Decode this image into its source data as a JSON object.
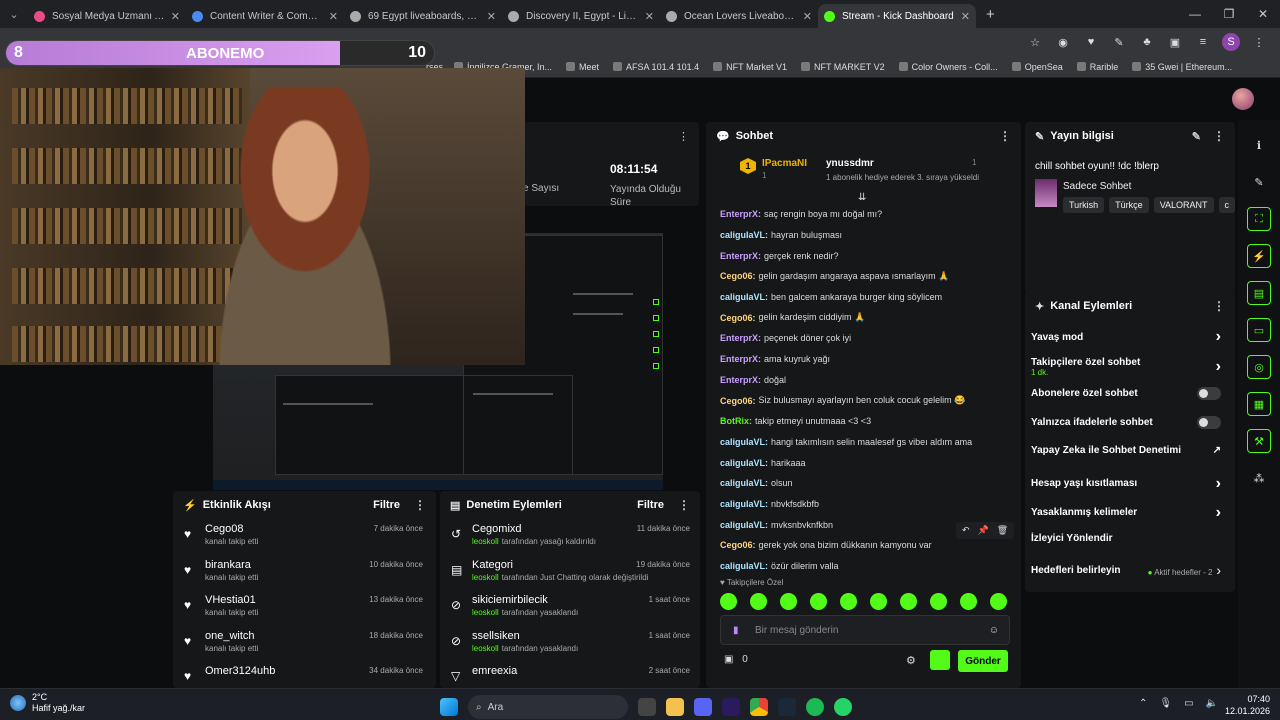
{
  "browser": {
    "tabs": [
      {
        "title": "Sosyal Medya Uzmanı Aranıyor",
        "color": "#e94b8a"
      },
      {
        "title": "Content Writer & Community M",
        "color": "#4b8af0"
      },
      {
        "title": "69 Egypt liveaboards, May 2026",
        "color": "#aaaaaa"
      },
      {
        "title": "Discovery II, Egypt - LiveAboard",
        "color": "#aaaaaa"
      },
      {
        "title": "Ocean Lovers Liveaboard, Egypt",
        "color": "#aaaaaa"
      },
      {
        "title": "Stream - Kick Dashboard",
        "color": "#53fc18",
        "active": true
      }
    ],
    "bookmarks": [
      "İngilizce Gramer, In...",
      "Meet",
      "AFSA 101.4 101.4",
      "NFT Market V1",
      "NFT MARKET V2",
      "Color Owners - Coll...",
      "OpenSea",
      "Rarible",
      "35 Gwei | Ethereum..."
    ],
    "bookmark_partial": "rses"
  },
  "overlay": {
    "left": "8",
    "title": "ABONEMO",
    "right": "10",
    "progress": 0.78
  },
  "stats": {
    "time": "08:11:54",
    "time_label": "Yayında Olduğu Süre",
    "viewers_label": "e Sayısı"
  },
  "activity": {
    "title": "Etkinlik Akışı",
    "filter": "Filtre",
    "items": [
      {
        "name": "Cego08",
        "sub": "kanalı takip etti",
        "time": "7 dakika önce"
      },
      {
        "name": "birankara",
        "sub": "kanalı takip etti",
        "time": "10 dakika önce"
      },
      {
        "name": "VHestia01",
        "sub": "kanalı takip etti",
        "time": "13 dakika önce"
      },
      {
        "name": "one_witch",
        "sub": "kanalı takip etti",
        "time": "18 dakika önce"
      },
      {
        "name": "Omer3124uhb",
        "sub": "",
        "time": "34 dakika önce"
      }
    ]
  },
  "moderation": {
    "title": "Denetim Eylemleri",
    "filter": "Filtre",
    "items": [
      {
        "name": "Cegomixd",
        "actor": "leoskoll",
        "action": "tarafından yasağı kaldırıldı",
        "time": "11 dakika önce"
      },
      {
        "name": "Kategori",
        "actor": "leoskoll",
        "action": "tarafından Just Chatting olarak değiştirildi",
        "time": "19 dakika önce"
      },
      {
        "name": "sikiciemirbilecik",
        "actor": "leoskoll",
        "action": "tarafından yasaklandı",
        "time": "1 saat önce"
      },
      {
        "name": "ssellsiken",
        "actor": "leoskoll",
        "action": "tarafından yasaklandı",
        "time": "1 saat önce"
      },
      {
        "name": "emreexia",
        "actor": "",
        "action": "",
        "time": "2 saat önce"
      }
    ]
  },
  "chat": {
    "title": "Sohbet",
    "top_gifter": "IPacmaNI",
    "top_gifter_count": "1",
    "gifter2": "ynussdmr",
    "gifter2_count": "1",
    "gifter2_text": "1 abonelik hediye ederek 3. sıraya yükseldi",
    "messages": [
      {
        "user": "EnterprX",
        "color": "#c9a0ff",
        "text": "saç rengin boya mı doğal mı?"
      },
      {
        "user": "caliguIaVL",
        "color": "#aee6ff",
        "text": "hayran buluşması"
      },
      {
        "user": "EnterprX",
        "color": "#c9a0ff",
        "text": "gerçek renk nedir?"
      },
      {
        "user": "Cego06",
        "color": "#ffd580",
        "text": "gelin gardaşım angaraya aspava ısmarlayım 🙏"
      },
      {
        "user": "caliguIaVL",
        "color": "#aee6ff",
        "text": "ben galcem ankaraya burger king söylicem"
      },
      {
        "user": "Cego06",
        "color": "#ffd580",
        "text": "gelin kardeşim ciddiyim 🙏"
      },
      {
        "user": "EnterprX",
        "color": "#c9a0ff",
        "text": "peçenek döner çok iyi"
      },
      {
        "user": "EnterprX",
        "color": "#c9a0ff",
        "text": "ama kuyruk yağı"
      },
      {
        "user": "EnterprX",
        "color": "#c9a0ff",
        "text": "doğal"
      },
      {
        "user": "Cego06",
        "color": "#ffd580",
        "text": "Siz bulusmayı ayarlayın ben coluk cocuk gelelim 😂"
      },
      {
        "user": "BotRix",
        "color": "#53fc18",
        "text": "takip etmeyi unutmaaa <3 <3"
      },
      {
        "user": "caliguIaVL",
        "color": "#aee6ff",
        "text": "hangi takımlısın selin maalesef gs vibeı aldım ama"
      },
      {
        "user": "caliguIaVL",
        "color": "#aee6ff",
        "text": "harikaaa"
      },
      {
        "user": "caliguIaVL",
        "color": "#aee6ff",
        "text": "olsun"
      },
      {
        "user": "caliguIaVL",
        "color": "#aee6ff",
        "text": "nbvkfsdkbfb"
      },
      {
        "user": "caliguIaVL",
        "color": "#aee6ff",
        "text": "mvksnbvknfkbn"
      },
      {
        "user": "Cego06",
        "color": "#ffd580",
        "text": "gerek yok ona bizim dükkanın kamyonu var"
      },
      {
        "user": "caliguIaVL",
        "color": "#aee6ff",
        "text": "özür dilerim valla"
      }
    ],
    "followers_only": "Takipçilere Özel",
    "placeholder": "Bir mesaj gönderin",
    "count": "0",
    "send": "Gönder"
  },
  "stream_info": {
    "title": "Yayın bilgisi",
    "stream_title": "chill sohbet oyun!! !dc !blerp",
    "category": "Sadece Sohbet",
    "tags": [
      "Turkish",
      "Türkçe",
      "VALORANT",
      "c"
    ]
  },
  "channel_actions": {
    "title": "Kanal Eylemleri",
    "rows": [
      {
        "label": "Yavaş mod",
        "sub": "",
        "kind": "chevron"
      },
      {
        "label": "Takipçilere özel sohbet",
        "sub": "1 dk.",
        "kind": "chevron"
      },
      {
        "label": "Abonelere özel sohbet",
        "sub": "",
        "kind": "toggle"
      },
      {
        "label": "Yalnızca ifadelerle sohbet",
        "sub": "",
        "kind": "toggle"
      },
      {
        "label": "Yapay Zeka ile Sohbet Denetimi",
        "sub": "",
        "kind": "link"
      },
      {
        "label": "Hesap yaşı kısıtlaması",
        "sub": "",
        "kind": "chevron"
      },
      {
        "label": "Yasaklanmış kelimeler",
        "sub": "",
        "kind": "chevron"
      },
      {
        "label": "İzleyici Yönlendir",
        "sub": "",
        "kind": "none"
      },
      {
        "label": "Hedefleri belirleyin",
        "sub": "",
        "kind": "goal",
        "extra": "Aktif hedefler - 2"
      }
    ]
  },
  "taskbar": {
    "temp": "2°C",
    "weather": "Hafif yağ./kar",
    "search": "Ara",
    "time": "07:40",
    "date": "12.01.2026"
  },
  "colors": {
    "accent": "#53fc18",
    "bg": "#0b0d0f",
    "panel": "#151719"
  }
}
